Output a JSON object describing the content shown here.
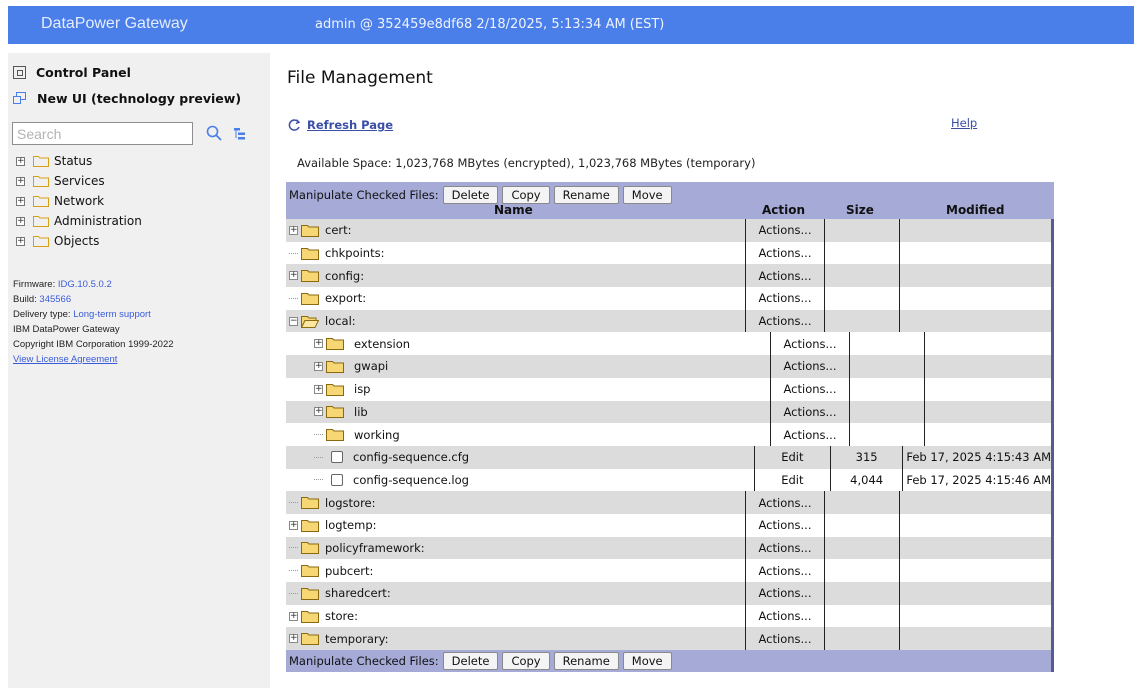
{
  "header": {
    "brand": "DataPower Gateway",
    "session": "admin @ 352459e8df68 2/18/2025, 5:13:34 AM (EST)"
  },
  "sidebar": {
    "control_panel": "Control Panel",
    "new_ui": "New UI (technology preview)",
    "search_placeholder": "Search",
    "nav": [
      {
        "label": "Status"
      },
      {
        "label": "Services"
      },
      {
        "label": "Network"
      },
      {
        "label": "Administration"
      },
      {
        "label": "Objects"
      }
    ],
    "meta": {
      "firmware_label": "Firmware:",
      "firmware": "IDG.10.5.0.2",
      "build_label": "Build:",
      "build": "345566",
      "delivery_label": "Delivery type:",
      "delivery": "Long-term support",
      "product": "IBM DataPower Gateway",
      "copyright": "Copyright IBM Corporation 1999-2022",
      "license_link": "View License Agreement"
    }
  },
  "main": {
    "title": "File Management",
    "refresh": "Refresh Page",
    "help": "Help",
    "available": "Available Space: 1,023,768 MBytes (encrypted), 1,023,768 MBytes (temporary)",
    "manipulate_label": "Manipulate Checked Files:",
    "buttons": {
      "delete": "Delete",
      "copy": "Copy",
      "rename": "Rename",
      "move": "Move"
    },
    "columns": {
      "name": "Name",
      "action": "Action",
      "size": "Size",
      "modified": "Modified"
    },
    "rows": [
      {
        "name": "cert:",
        "action": "Actions...",
        "size": "",
        "modified": ""
      },
      {
        "name": "chkpoints:",
        "action": "Actions...",
        "size": "",
        "modified": ""
      },
      {
        "name": "config:",
        "action": "Actions...",
        "size": "",
        "modified": ""
      },
      {
        "name": "export:",
        "action": "Actions...",
        "size": "",
        "modified": ""
      },
      {
        "name": "local:",
        "action": "Actions...",
        "size": "",
        "modified": ""
      },
      {
        "name": "extension",
        "action": "Actions...",
        "size": "",
        "modified": ""
      },
      {
        "name": "gwapi",
        "action": "Actions...",
        "size": "",
        "modified": ""
      },
      {
        "name": "isp",
        "action": "Actions...",
        "size": "",
        "modified": ""
      },
      {
        "name": "lib",
        "action": "Actions...",
        "size": "",
        "modified": ""
      },
      {
        "name": "working",
        "action": "Actions...",
        "size": "",
        "modified": ""
      },
      {
        "name": "config-sequence.cfg",
        "action": "Edit",
        "size": "315",
        "modified": "Feb 17, 2025 4:15:43 AM"
      },
      {
        "name": "config-sequence.log",
        "action": "Edit",
        "size": "4,044",
        "modified": "Feb 17, 2025 4:15:46 AM"
      },
      {
        "name": "logstore:",
        "action": "Actions...",
        "size": "",
        "modified": ""
      },
      {
        "name": "logtemp:",
        "action": "Actions...",
        "size": "",
        "modified": ""
      },
      {
        "name": "policyframework:",
        "action": "Actions...",
        "size": "",
        "modified": ""
      },
      {
        "name": "pubcert:",
        "action": "Actions...",
        "size": "",
        "modified": ""
      },
      {
        "name": "sharedcert:",
        "action": "Actions...",
        "size": "",
        "modified": ""
      },
      {
        "name": "store:",
        "action": "Actions...",
        "size": "",
        "modified": ""
      },
      {
        "name": "temporary:",
        "action": "Actions...",
        "size": "",
        "modified": ""
      }
    ]
  }
}
